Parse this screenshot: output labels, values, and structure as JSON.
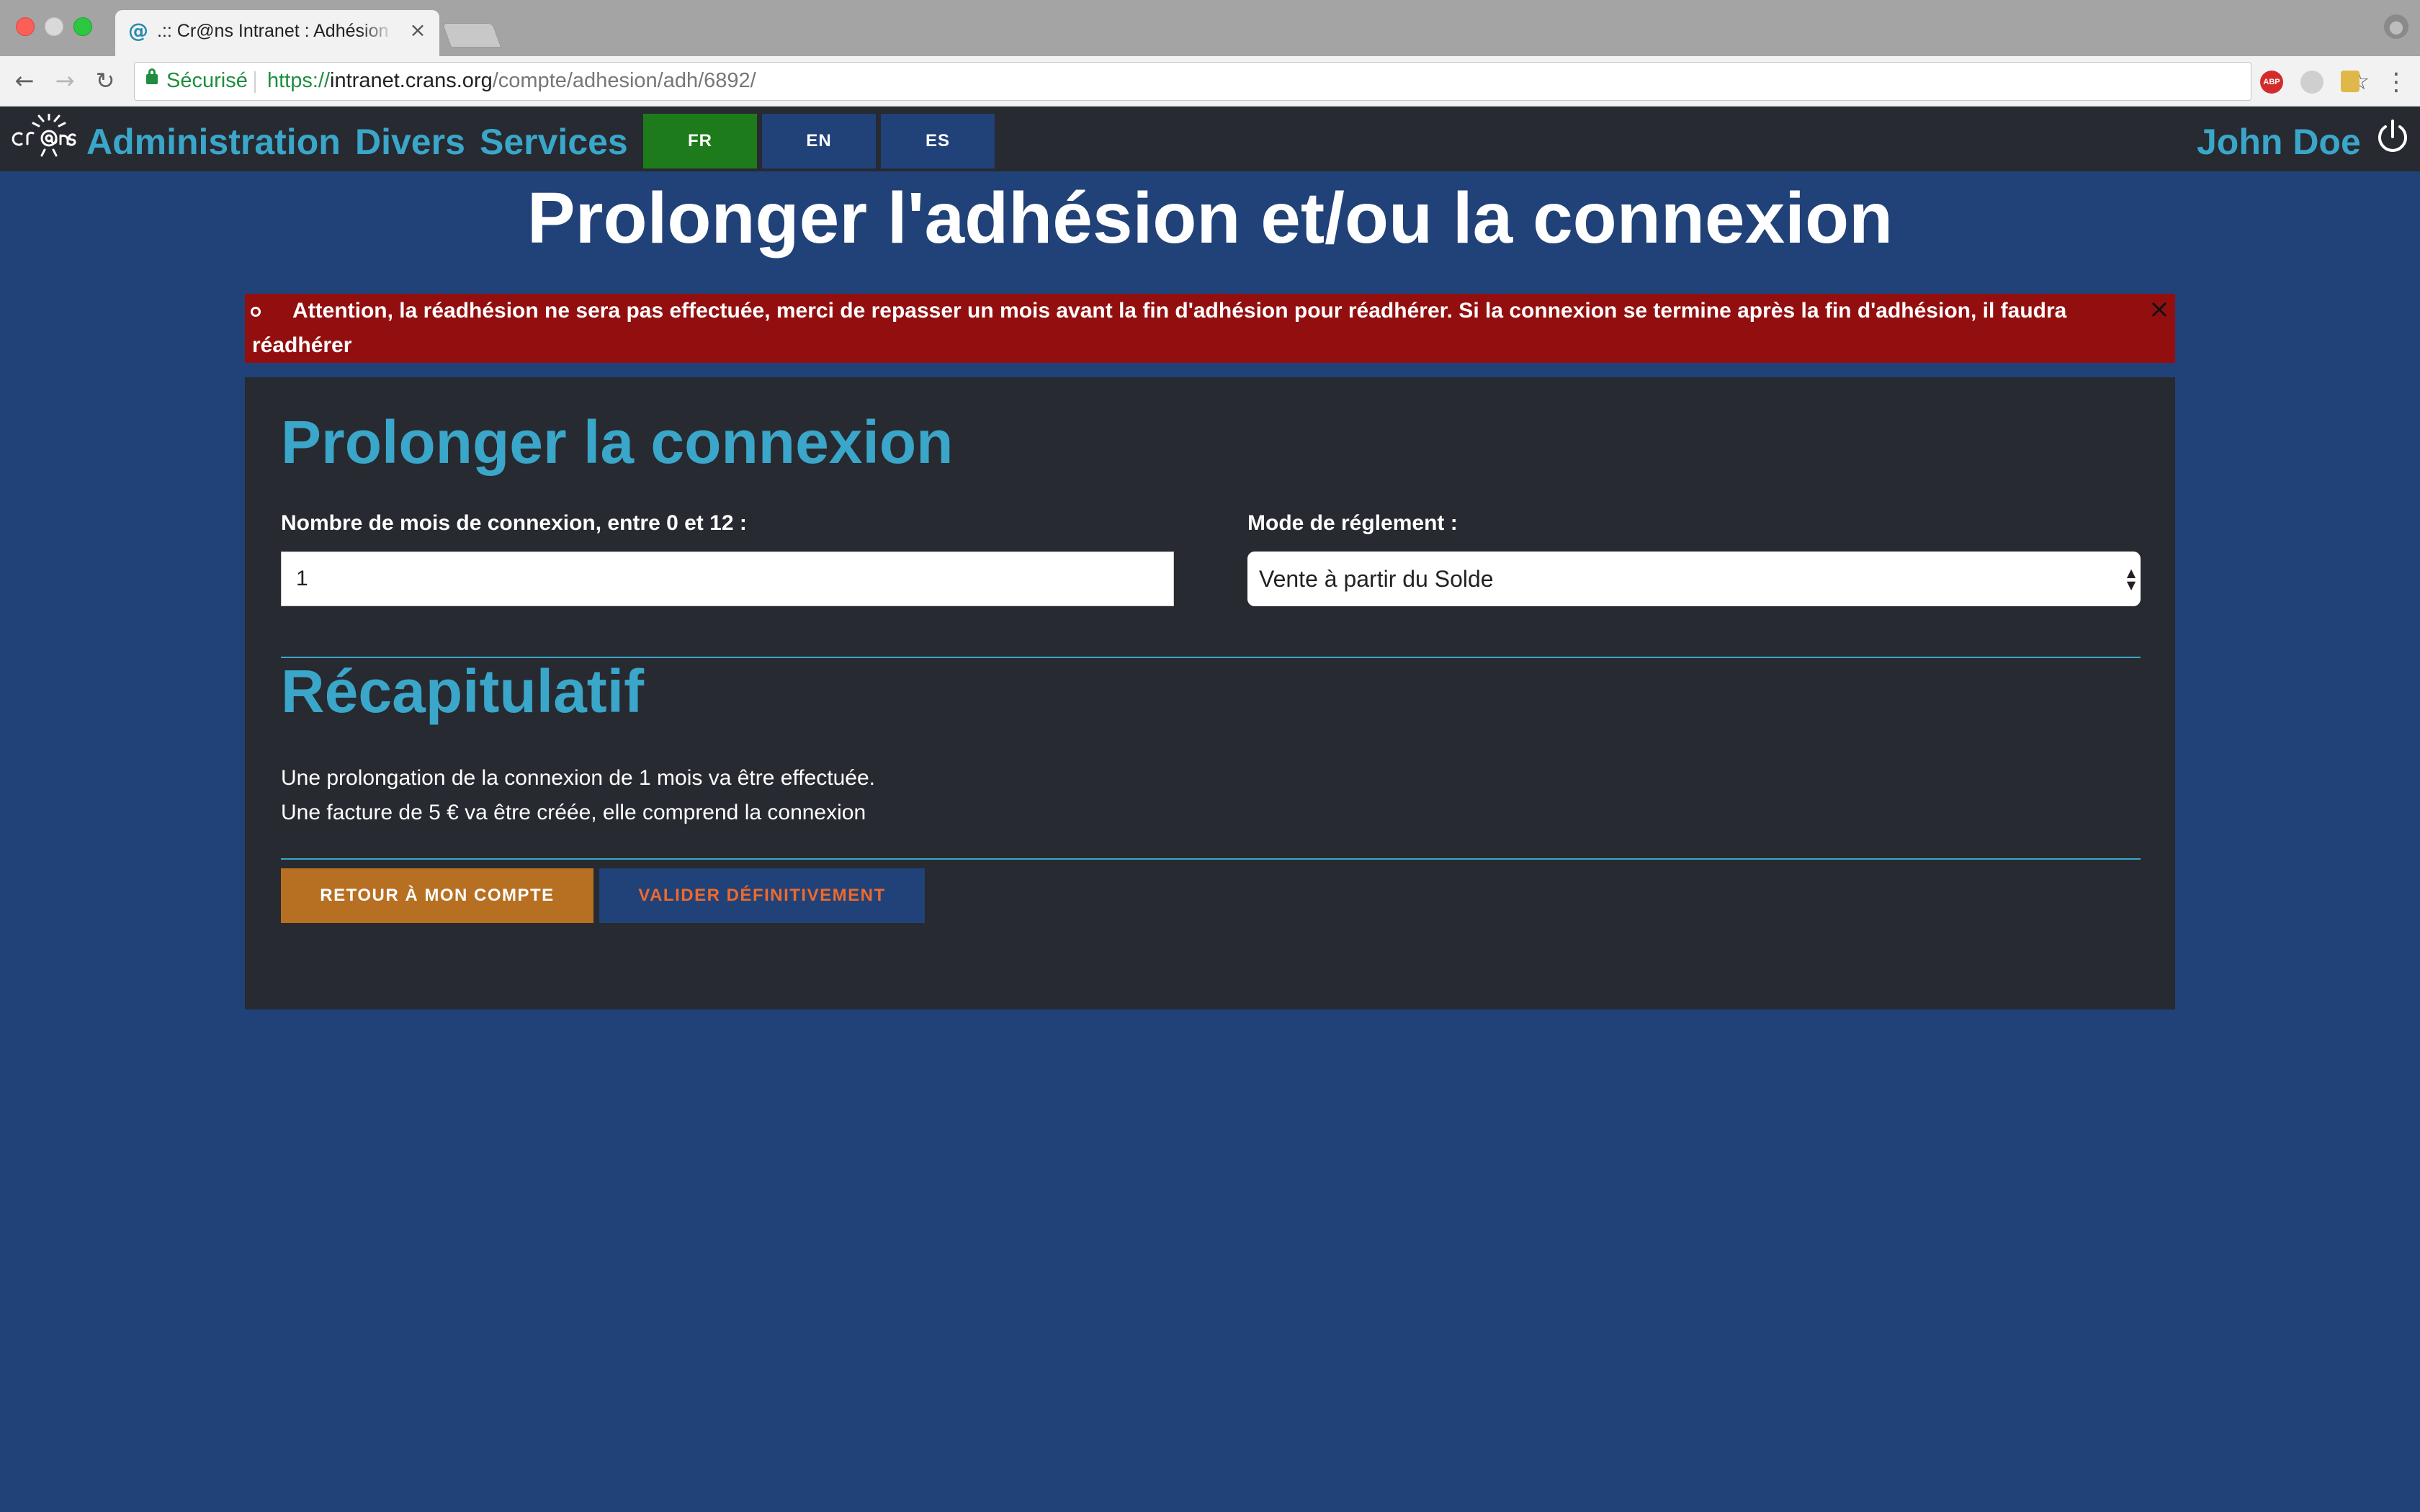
{
  "browser": {
    "tab_title": ".:: Cr@ns Intranet : Adhésion et connexion",
    "tab_close": "×",
    "secure_label": "Sécurisé",
    "url_scheme": "https://",
    "url_host": "intranet.crans.org",
    "url_path": "/compte/adhesion/adh/6892/",
    "abp_label": "ABP"
  },
  "navbar": {
    "links": [
      "Administration",
      "Divers",
      "Services"
    ],
    "languages": [
      "FR",
      "EN",
      "ES"
    ],
    "active_language": "FR",
    "user_name": "John Doe"
  },
  "page": {
    "title": "Prolonger l'adhésion et/ou la connexion",
    "alert": "Attention, la réadhésion ne sera pas effectuée, merci de repasser un mois avant la fin d'adhésion pour réadhérer. Si la connexion se termine après la fin d'adhésion, il faudra réadhérer",
    "alert_close": "×"
  },
  "form": {
    "heading": "Prolonger la connexion",
    "months_label": "Nombre de mois de connexion, entre 0 et 12 :",
    "months_value": "1",
    "payment_label": "Mode de réglement :",
    "payment_value": "Vente à partir du Solde"
  },
  "recap": {
    "heading": "Récapitulatif",
    "line1": "Une prolongation de la connexion de 1 mois va être effectuée.",
    "line2": "Une facture de 5 € va être créée, elle comprend la connexion"
  },
  "buttons": {
    "back": "RETOUR À MON COMPTE",
    "confirm": "VALIDER DÉFINITIVEMENT"
  },
  "colors": {
    "background": "#204278",
    "navbar": "#272a30",
    "accent": "#3aa6c9",
    "alert": "#930f0f",
    "lang_active": "#1e7b1b",
    "btn_back": "#b76f21",
    "btn_confirm_text": "#f0692a"
  }
}
